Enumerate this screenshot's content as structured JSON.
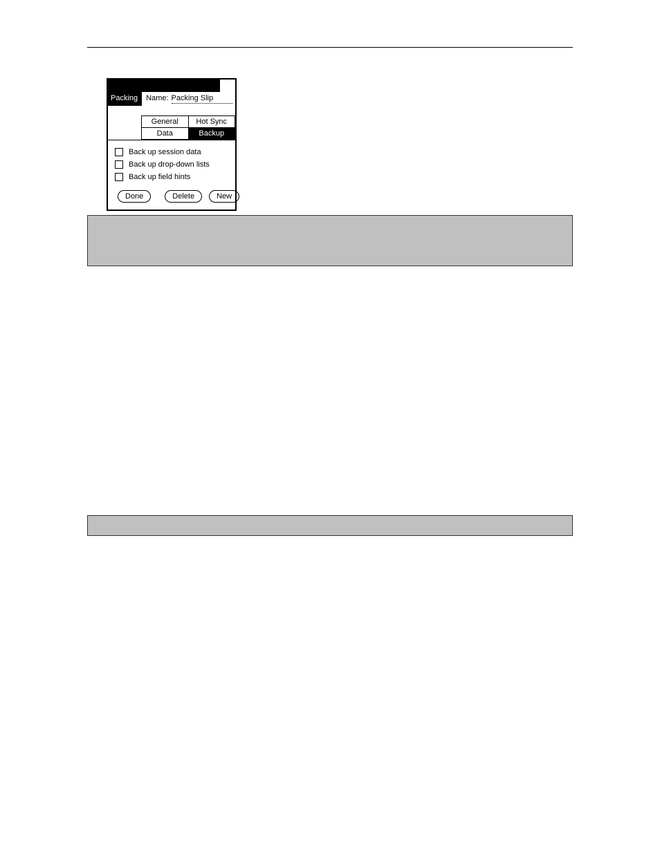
{
  "palm": {
    "side_tab_label": "Packing",
    "name_label": "Name:",
    "name_value": "Packing Slip",
    "tabs": {
      "general": "General",
      "hotsync": "Hot Sync",
      "data": "Data",
      "backup": "Backup"
    },
    "checkboxes": {
      "session": "Back up session data",
      "dropdowns": "Back up drop-down lists",
      "hints": "Back up field hints"
    },
    "buttons": {
      "done": "Done",
      "delete": "Delete",
      "new": "New"
    }
  }
}
